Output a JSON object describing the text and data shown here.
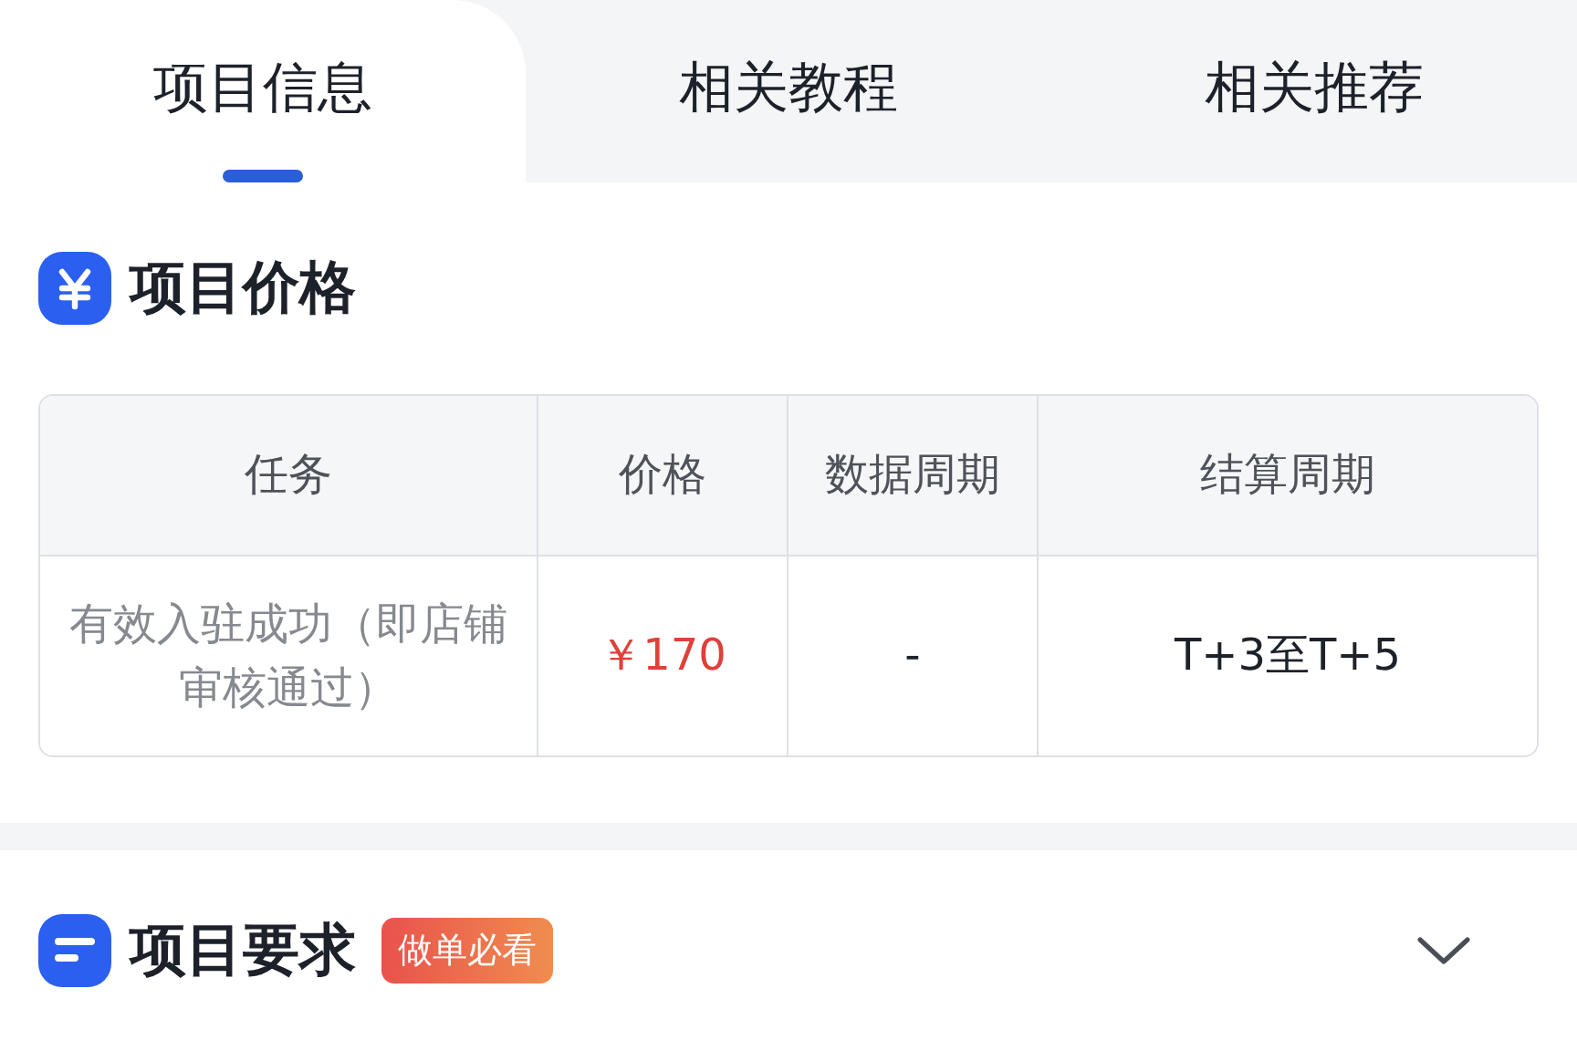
{
  "tabs": [
    {
      "label": "项目信息",
      "selected": true
    },
    {
      "label": "相关教程",
      "selected": false
    },
    {
      "label": "相关推荐",
      "selected": false
    }
  ],
  "price_section": {
    "title": "项目价格",
    "table": {
      "columns": [
        "任务",
        "价格",
        "数据周期",
        "结算周期"
      ],
      "rows": [
        {
          "task": "有效入驻成功（即店铺审核通过）",
          "price": "￥170",
          "data_period": "-",
          "settlement_period": "T+3至T+5"
        }
      ]
    }
  },
  "requirements_section": {
    "title": "项目要求",
    "badge": "做单必看",
    "expanded": false
  }
}
